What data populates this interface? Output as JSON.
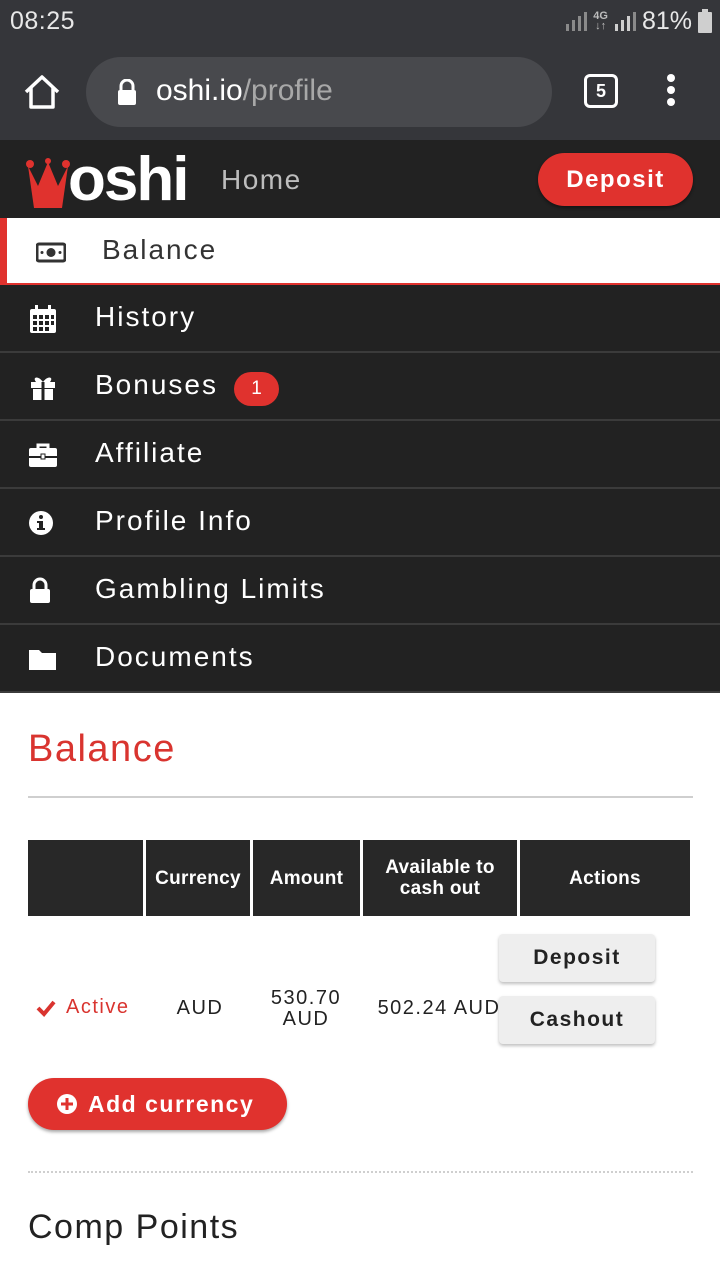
{
  "status_bar": {
    "time": "08:25",
    "network": "4G",
    "battery": "81%"
  },
  "browser": {
    "url_domain": "oshi.io",
    "url_path": "/profile",
    "tab_count": "5"
  },
  "header": {
    "logo_text": "oshi",
    "nav_home": "Home",
    "deposit_label": "Deposit"
  },
  "menu": {
    "items": [
      {
        "label": "Balance",
        "icon": "money-icon",
        "active": true
      },
      {
        "label": "History",
        "icon": "calendar-icon"
      },
      {
        "label": "Bonuses",
        "icon": "gift-icon",
        "badge": "1"
      },
      {
        "label": "Affiliate",
        "icon": "briefcase-icon"
      },
      {
        "label": "Profile Info",
        "icon": "info-icon"
      },
      {
        "label": "Gambling Limits",
        "icon": "lock-icon"
      },
      {
        "label": "Documents",
        "icon": "folder-icon"
      }
    ]
  },
  "balance": {
    "title": "Balance",
    "table": {
      "headers": [
        "",
        "Currency",
        "Amount",
        "Available to cash out",
        "Actions"
      ],
      "row": {
        "status": "Active",
        "currency": "AUD",
        "amount": "530.70 AUD",
        "available": "502.24 AUD",
        "deposit_label": "Deposit",
        "cashout_label": "Cashout"
      }
    },
    "add_currency_label": "Add currency"
  },
  "comp_points": {
    "title": "Comp Points"
  },
  "colors": {
    "accent": "#e0322e",
    "dark": "#222222",
    "browser": "#35363a"
  }
}
